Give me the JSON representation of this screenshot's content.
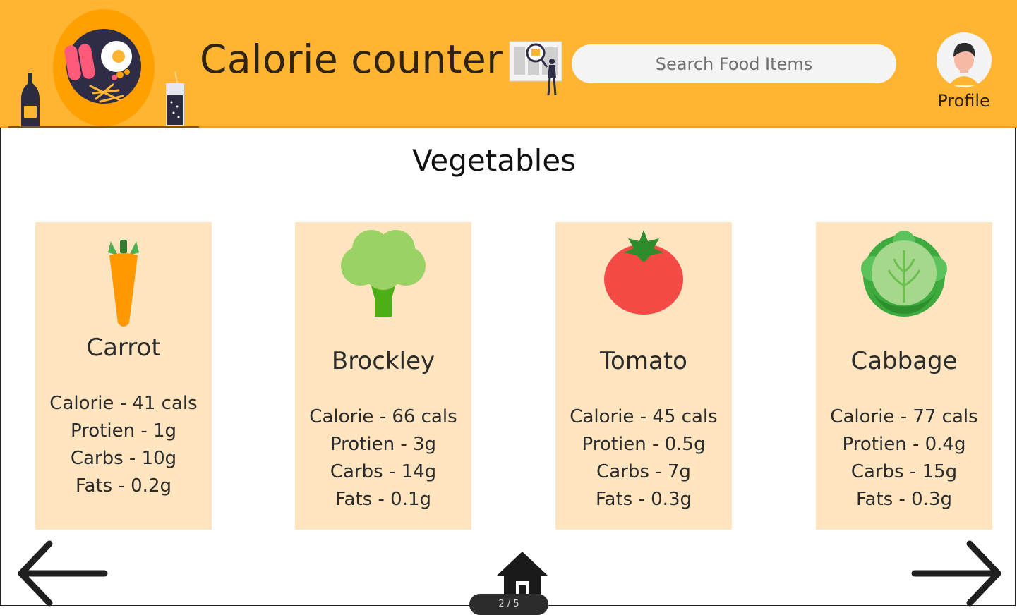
{
  "header": {
    "title": "Calorie counter",
    "search_placeholder": "Search Food Items",
    "profile_label": "Profile",
    "background_color": "#ffb531"
  },
  "section_title": "Vegetables",
  "cards": [
    {
      "name": "Carrot",
      "icon": "carrot-icon",
      "calorie": "Calorie - 41 cals",
      "protien": "Protien - 1g",
      "carbs": "Carbs - 10g",
      "fats": "Fats - 0.2g"
    },
    {
      "name": "Brockley",
      "icon": "broccoli-icon",
      "calorie": "Calorie - 66 cals",
      "protien": "Protien - 3g",
      "carbs": "Carbs - 14g",
      "fats": "Fats - 0.1g"
    },
    {
      "name": "Tomato",
      "icon": "tomato-icon",
      "calorie": "Calorie - 45 cals",
      "protien": "Protien - 0.5g",
      "carbs": "Carbs - 7g",
      "fats": "Fats - 0.3g"
    },
    {
      "name": "Cabbage",
      "icon": "cabbage-icon",
      "calorie": "Calorie - 77 cals",
      "protien": "Protien - 0.4g",
      "carbs": "Carbs - 15g",
      "fats": "Fats - 0.3g"
    }
  ],
  "nav": {
    "prev_icon": "arrow-left-icon",
    "next_icon": "arrow-right-icon",
    "home_icon": "home-icon",
    "pager_text": "2 / 5"
  },
  "colors": {
    "card_bg": "#ffe4c0",
    "header_bg": "#ffb531"
  }
}
